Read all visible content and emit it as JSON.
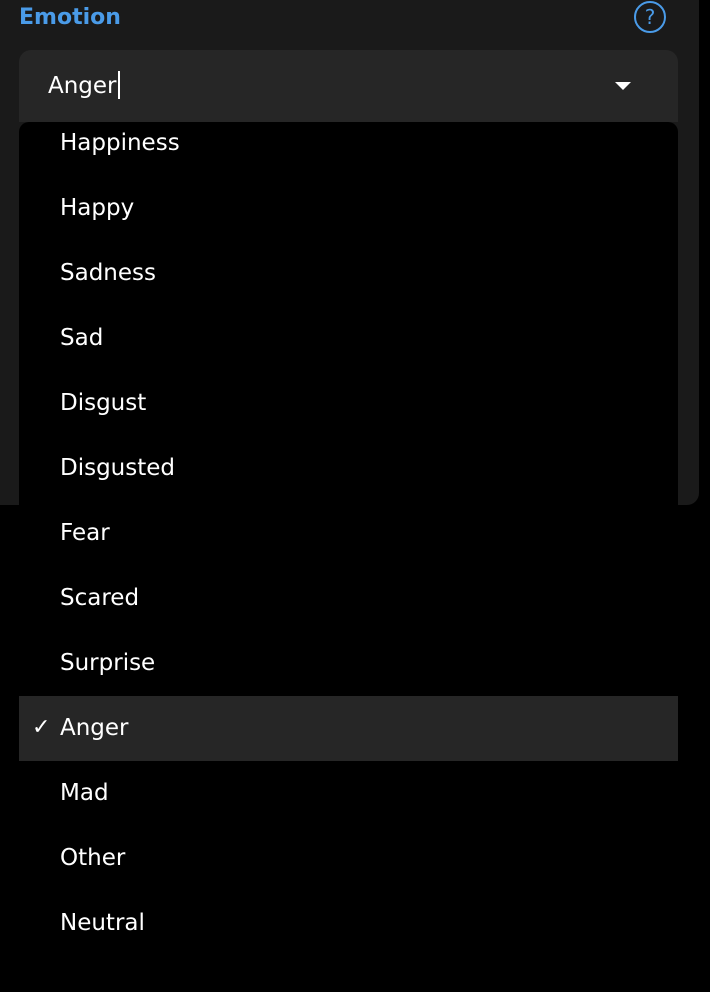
{
  "field": {
    "label": "Emotion",
    "help_icon": "question-mark-icon",
    "help_glyph": "?",
    "value": "Anger",
    "dropdown_icon": "triangle-down-icon"
  },
  "options": [
    {
      "label": "Happiness",
      "selected": false
    },
    {
      "label": "Happy",
      "selected": false
    },
    {
      "label": "Sadness",
      "selected": false
    },
    {
      "label": "Sad",
      "selected": false
    },
    {
      "label": "Disgust",
      "selected": false
    },
    {
      "label": "Disgusted",
      "selected": false
    },
    {
      "label": "Fear",
      "selected": false
    },
    {
      "label": "Scared",
      "selected": false
    },
    {
      "label": "Surprise",
      "selected": false
    },
    {
      "label": "Anger",
      "selected": true
    },
    {
      "label": "Mad",
      "selected": false
    },
    {
      "label": "Other",
      "selected": false
    },
    {
      "label": "Neutral",
      "selected": false
    }
  ],
  "check_glyph": "✓",
  "colors": {
    "accent": "#4a9be8",
    "panel_bg": "#1a1a1a",
    "input_bg": "#262626",
    "menu_bg": "#000000",
    "selected_bg": "#262626",
    "text": "#ffffff"
  }
}
